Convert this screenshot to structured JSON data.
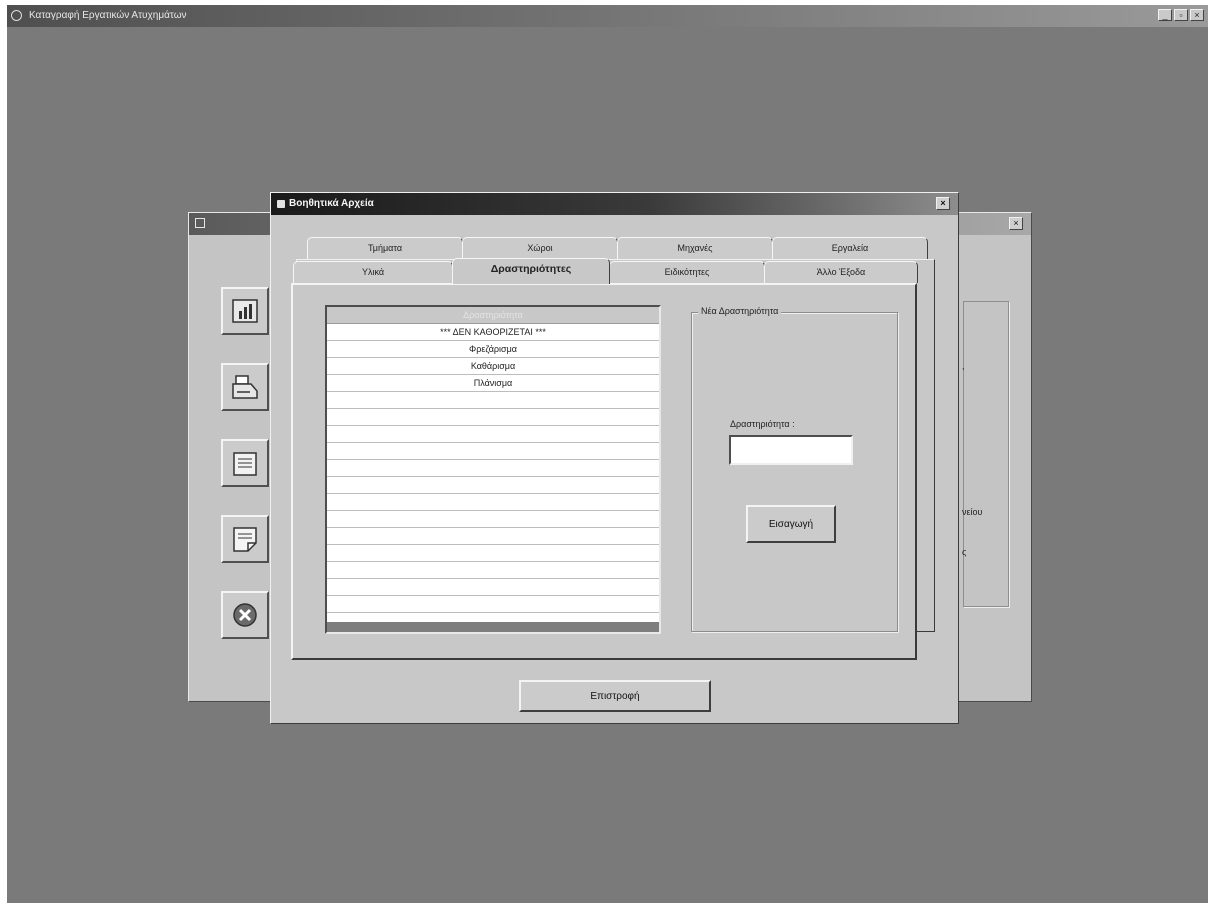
{
  "app": {
    "title": "Καταγραφή Εργατικών Ατυχημάτων",
    "controls": [
      "_",
      "▫",
      "×"
    ]
  },
  "back_window": {
    "close_label": "×",
    "fragments": [
      "νείου",
      "ς"
    ]
  },
  "dialog": {
    "title": "Βοηθητικά Αρχεία",
    "close_label": "×",
    "tabs_row1": [
      "Τμήματα",
      "Χώροι",
      "Μηχανές",
      "Εργαλεία"
    ],
    "tabs_row2": [
      "Υλικά",
      "Δραστηριότητες",
      "Ειδικότητες",
      "Άλλο Έξοδα"
    ],
    "active_tab": "Δραστηριότητες",
    "list": {
      "header": "Δραστηριότητα",
      "rows": [
        "*** ΔΕΝ ΚΑΘΟΡΙΖΕΤΑΙ ***",
        "Φρεζάρισμα",
        "Καθάρισμα",
        "Πλάνισμα",
        "",
        "",
        "",
        "",
        "",
        "",
        "",
        "",
        "",
        "",
        "",
        "",
        "",
        ""
      ]
    },
    "new_activity": {
      "group_title": "Νέα Δραστηριότητα",
      "field_label": "Δραστηριότητα :",
      "field_value": "",
      "insert_label": "Εισαγωγή"
    },
    "return_label": "Επιστροφή"
  }
}
